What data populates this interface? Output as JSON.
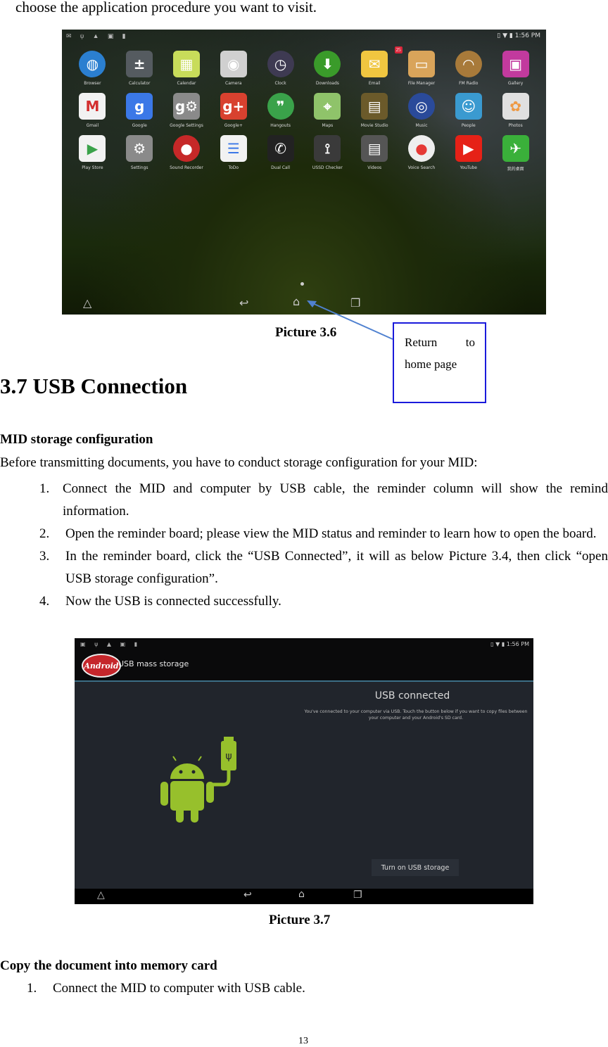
{
  "intro_text": "choose the application procedure you want to visit.",
  "picture36": {
    "status_left_icons": [
      "mail-icon",
      "usb-icon",
      "notification-icon",
      "screenshot-icon",
      "sd-icon"
    ],
    "status_time": "1:56 PM",
    "apps": [
      {
        "label": "Browser",
        "icon": "globe-icon",
        "color": "#2b7fd0",
        "glyph": "◍"
      },
      {
        "label": "Calculator",
        "icon": "calculator-icon",
        "color": "#555b60",
        "glyph": "±"
      },
      {
        "label": "Calendar",
        "icon": "calendar-icon",
        "color": "#c8dc5a",
        "glyph": "▦"
      },
      {
        "label": "Camera",
        "icon": "camera-icon",
        "color": "#d0d0d0",
        "glyph": "◉"
      },
      {
        "label": "Clock",
        "icon": "clock-icon",
        "color": "#3e3a52",
        "glyph": "◷"
      },
      {
        "label": "Downloads",
        "icon": "download-icon",
        "color": "#3a9b2a",
        "glyph": "⬇"
      },
      {
        "label": "Email",
        "icon": "email-icon",
        "color": "#f0c640",
        "glyph": "✉",
        "badge": "25"
      },
      {
        "label": "File Manager",
        "icon": "folder-icon",
        "color": "#d9a45a",
        "glyph": "▭"
      },
      {
        "label": "FM Radio",
        "icon": "radio-icon",
        "color": "#a87a3a",
        "glyph": "◠"
      },
      {
        "label": "Gallery",
        "icon": "gallery-icon",
        "color": "#c23a9e",
        "glyph": "▣"
      },
      {
        "label": "Gmail",
        "icon": "gmail-icon",
        "color": "#f2f2f2",
        "glyph": "M",
        "fg": "#d32f2f"
      },
      {
        "label": "Google",
        "icon": "google-icon",
        "color": "#3b78e7",
        "glyph": "g"
      },
      {
        "label": "Google Settings",
        "icon": "google-settings-icon",
        "color": "#8a8a8a",
        "glyph": "g⚙"
      },
      {
        "label": "Google+",
        "icon": "google-plus-icon",
        "color": "#d8412f",
        "glyph": "g+"
      },
      {
        "label": "Hangouts",
        "icon": "hangouts-icon",
        "color": "#3aa24a",
        "glyph": "❞"
      },
      {
        "label": "Maps",
        "icon": "maps-icon",
        "color": "#8fc36a",
        "glyph": "⌖"
      },
      {
        "label": "Movie Studio",
        "icon": "movie-studio-icon",
        "color": "#6b5a2a",
        "glyph": "▤"
      },
      {
        "label": "Music",
        "icon": "music-icon",
        "color": "#2a4a9a",
        "glyph": "◎"
      },
      {
        "label": "People",
        "icon": "people-icon",
        "color": "#3a9ad0",
        "glyph": "☺"
      },
      {
        "label": "Photos",
        "icon": "photos-icon",
        "color": "#e0e0e0",
        "glyph": "✿",
        "fg": "#e94"
      },
      {
        "label": "Play Store",
        "icon": "play-store-icon",
        "color": "#f2f2f2",
        "glyph": "▶",
        "fg": "#3aa24a"
      },
      {
        "label": "Settings",
        "icon": "settings-icon",
        "color": "#8a8a8a",
        "glyph": "⚙"
      },
      {
        "label": "Sound Recorder",
        "icon": "microphone-icon",
        "color": "#c62828",
        "glyph": "●"
      },
      {
        "label": "ToDo",
        "icon": "todo-icon",
        "color": "#f2f2f2",
        "glyph": "☰",
        "fg": "#3b78e7"
      },
      {
        "label": "Dual Call",
        "icon": "phone-icon",
        "color": "#222",
        "glyph": "✆"
      },
      {
        "label": "USSD Checker",
        "icon": "antenna-icon",
        "color": "#3a3a3a",
        "glyph": "⟟"
      },
      {
        "label": "Videos",
        "icon": "video-icon",
        "color": "#555",
        "glyph": "▤"
      },
      {
        "label": "Voice Search",
        "icon": "voice-search-icon",
        "color": "#eeeeee",
        "glyph": "●",
        "fg": "#e53935"
      },
      {
        "label": "YouTube",
        "icon": "youtube-icon",
        "color": "#e62117",
        "glyph": "▶"
      },
      {
        "label": "我的桌面",
        "icon": "green-app-icon",
        "color": "#3ab03a",
        "glyph": "✈"
      }
    ],
    "caption": "Picture 3.6",
    "callout_line1_a": "Return",
    "callout_line1_b": "to",
    "callout_line2": "home page"
  },
  "section_title": "3.7 USB Connection",
  "mid_config": {
    "heading": "MID storage configuration",
    "intro": "Before transmitting documents, you have to conduct storage configuration for your MID:",
    "steps": [
      {
        "num": "1.",
        "text": "Connect the MID and computer by USB cable, the reminder column will show the remind information."
      },
      {
        "num": "2.",
        "text": "Open the reminder board; please view the MID status and reminder to learn how to open the board."
      },
      {
        "num": "3.",
        "text": "In the reminder board, click the “USB Connected”, it will as below Picture 3.4, then click “open USB storage configuration”."
      },
      {
        "num": "4.",
        "text": "Now the USB is connected successfully."
      }
    ]
  },
  "picture37": {
    "status_time": "1:56 PM",
    "app_title": "USB mass storage",
    "logo_text": "Android",
    "heading": "USB connected",
    "description": "You've connected to your computer via USB. Touch the button below if you want to copy files between your computer and your Android's SD card.",
    "button_label": "Turn on USB storage",
    "caption": "Picture 3.7"
  },
  "copy_section": {
    "heading": "Copy the document into memory card",
    "steps": [
      {
        "num": "1.",
        "text": "Connect the MID to computer with USB cable."
      }
    ]
  },
  "page_number": "13"
}
